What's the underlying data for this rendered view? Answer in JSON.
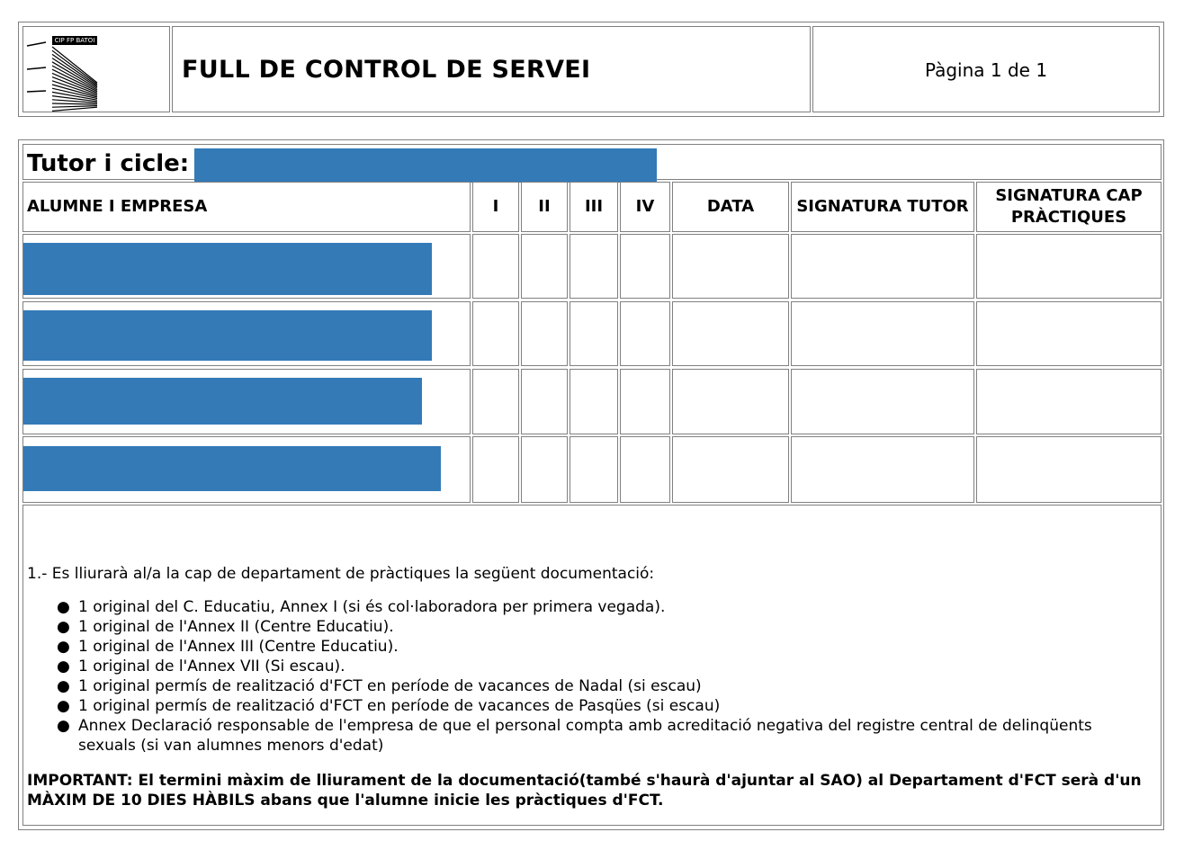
{
  "header": {
    "logo_text": "CIP FP BATOI",
    "title": "FULL DE CONTROL DE SERVEI",
    "page_label": "Pàgina 1 de 1"
  },
  "table": {
    "tutor_label": "Tutor i cicle:",
    "columns": [
      "ALUMNE I EMPRESA",
      "I",
      "II",
      "III",
      "IV",
      "DATA",
      "SIGNATURA TUTOR",
      "SIGNATURA CAP PRÀCTIQUES"
    ],
    "row_count": 4
  },
  "notes": {
    "intro": "1.- Es lliurarà al/a la cap de departament de pràctiques la següent documentació:",
    "items": [
      "1 original del C. Educatiu, Annex I (si és col·laboradora per primera vegada).",
      "1 original de l'Annex II (Centre Educatiu).",
      "1 original de l'Annex III (Centre Educatiu).",
      "1 original de l'Annex VII (Si escau).",
      "1 original permís de realització d'FCT en període de vacances de Nadal (si escau)",
      "1 original permís de realització d'FCT en període de vacances de Pasqües (si escau)",
      "Annex Declaració responsable de l'empresa de que el personal compta amb acreditació negativa del registre central de delinqüents sexuals (si van alumnes menors d'edat)"
    ],
    "important": "IMPORTANT: El termini màxim de lliurament de la documentació(també s'haurà d'ajuntar al SAO) al Departament d'FCT serà d'un MÀXIM DE 10 DIES HÀBILS abans que l'alumne inicie les pràctiques d'FCT."
  },
  "colors": {
    "border": "#808080",
    "redaction": "#337ab7"
  }
}
